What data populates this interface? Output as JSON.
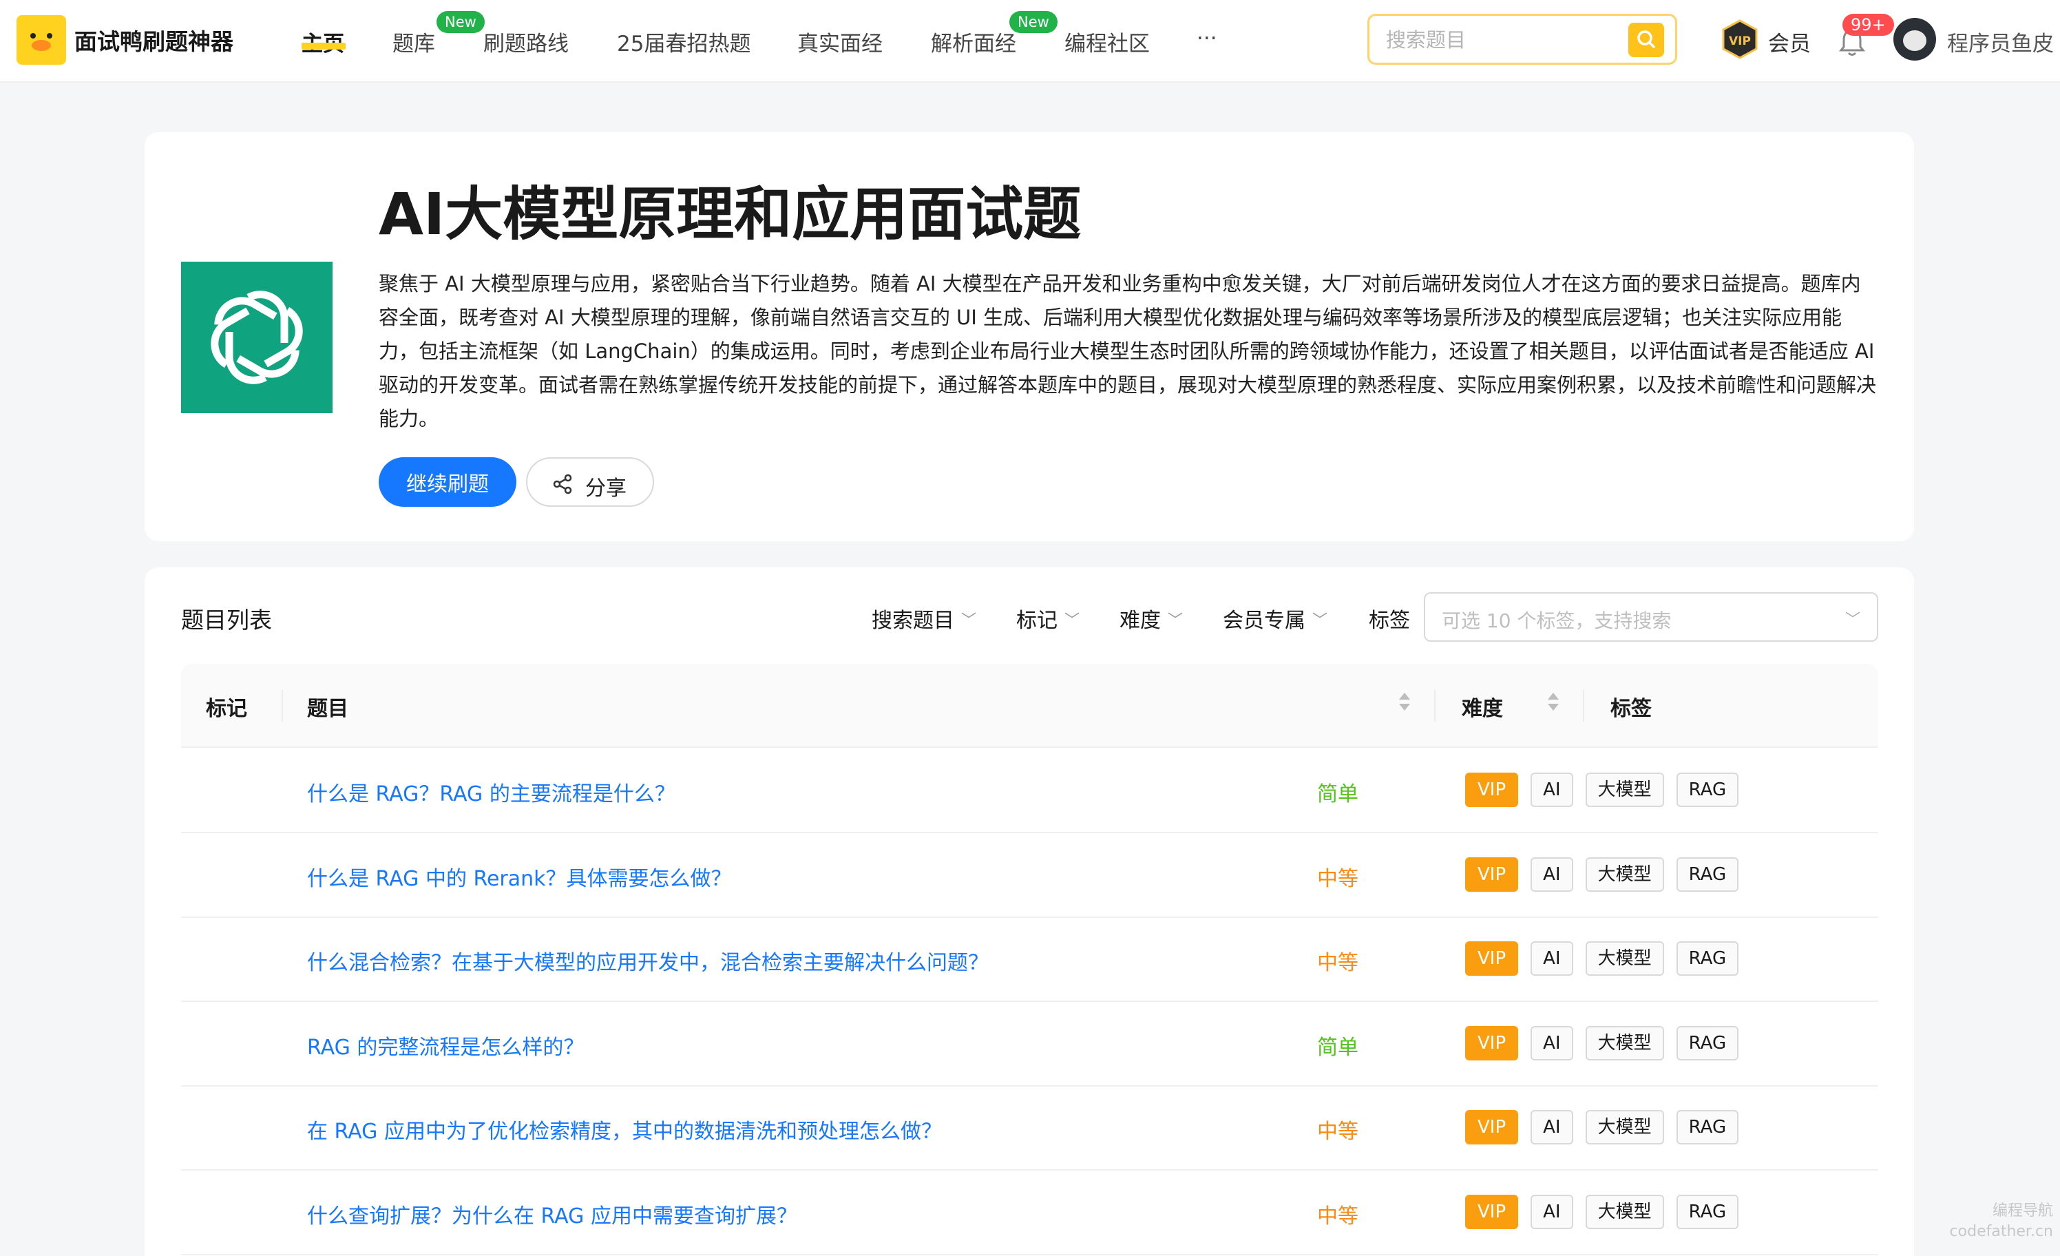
{
  "header": {
    "brand": "面试鸭刷题神器",
    "nav": [
      {
        "label": "主页",
        "active": true
      },
      {
        "label": "题库",
        "badge": "New"
      },
      {
        "label": "刷题路线"
      },
      {
        "label": "25届春招热题"
      },
      {
        "label": "真实面经"
      },
      {
        "label": "解析面经",
        "badge": "New"
      },
      {
        "label": "编程社区"
      },
      {
        "label": "···"
      }
    ],
    "search_placeholder": "搜索题目",
    "vip_label": "会员",
    "vip_icon_text": "VIP",
    "notification_count": "99+",
    "username": "程序员鱼皮"
  },
  "hero": {
    "title": "AI大模型原理和应用面试题",
    "description": "聚焦于 AI 大模型原理与应用，紧密贴合当下行业趋势。随着 AI 大模型在产品开发和业务重构中愈发关键，大厂对前后端研发岗位人才在这方面的要求日益提高。题库内容全面，既考查对 AI 大模型原理的理解，像前端自然语言交互的 UI 生成、后端利用大模型优化数据处理与编码效率等场景所涉及的模型底层逻辑；也关注实际应用能力，包括主流框架（如 LangChain）的集成运用。同时，考虑到企业布局行业大模型生态时团队所需的跨领域协作能力，还设置了相关题目，以评估面试者是否能适应 AI 驱动的开发变革。面试者需在熟练掌握传统开发技能的前提下，通过解答本题库中的题目，展现对大模型原理的熟悉程度、实际应用案例积累，以及技术前瞻性和问题解决能力。",
    "continue_label": "继续刷题",
    "share_label": "分享"
  },
  "list": {
    "title": "题目列表",
    "filters": [
      "搜索题目",
      "标记",
      "难度",
      "会员专属"
    ],
    "tag_filter_label": "标签",
    "tag_filter_placeholder": "可选 10 个标签，支持搜索",
    "columns": {
      "mark": "标记",
      "title": "题目",
      "difficulty": "难度",
      "tags": "标签"
    },
    "rows": [
      {
        "title": "什么是 RAG？RAG 的主要流程是什么？",
        "difficulty": "简单",
        "tags": [
          "VIP",
          "AI",
          "大模型",
          "RAG"
        ]
      },
      {
        "title": "什么是 RAG 中的 Rerank？具体需要怎么做？",
        "difficulty": "中等",
        "tags": [
          "VIP",
          "AI",
          "大模型",
          "RAG"
        ]
      },
      {
        "title": "什么混合检索？在基于大模型的应用开发中，混合检索主要解决什么问题？",
        "difficulty": "中等",
        "tags": [
          "VIP",
          "AI",
          "大模型",
          "RAG"
        ]
      },
      {
        "title": "RAG 的完整流程是怎么样的？",
        "difficulty": "简单",
        "tags": [
          "VIP",
          "AI",
          "大模型",
          "RAG"
        ]
      },
      {
        "title": "在 RAG 应用中为了优化检索精度，其中的数据清洗和预处理怎么做？",
        "difficulty": "中等",
        "tags": [
          "VIP",
          "AI",
          "大模型",
          "RAG"
        ]
      },
      {
        "title": "什么查询扩展？为什么在 RAG 应用中需要查询扩展？",
        "difficulty": "中等",
        "tags": [
          "VIP",
          "AI",
          "大模型",
          "RAG"
        ]
      }
    ]
  },
  "colors": {
    "accent": "#1677ff",
    "easy": "#52c41a",
    "medium": "#fa8c16",
    "vip": "#fa9d0f",
    "brand_yellow": "#ffd21f",
    "openai_green": "#10a37f"
  },
  "watermark": [
    "编程导航",
    "codefather.cn"
  ]
}
